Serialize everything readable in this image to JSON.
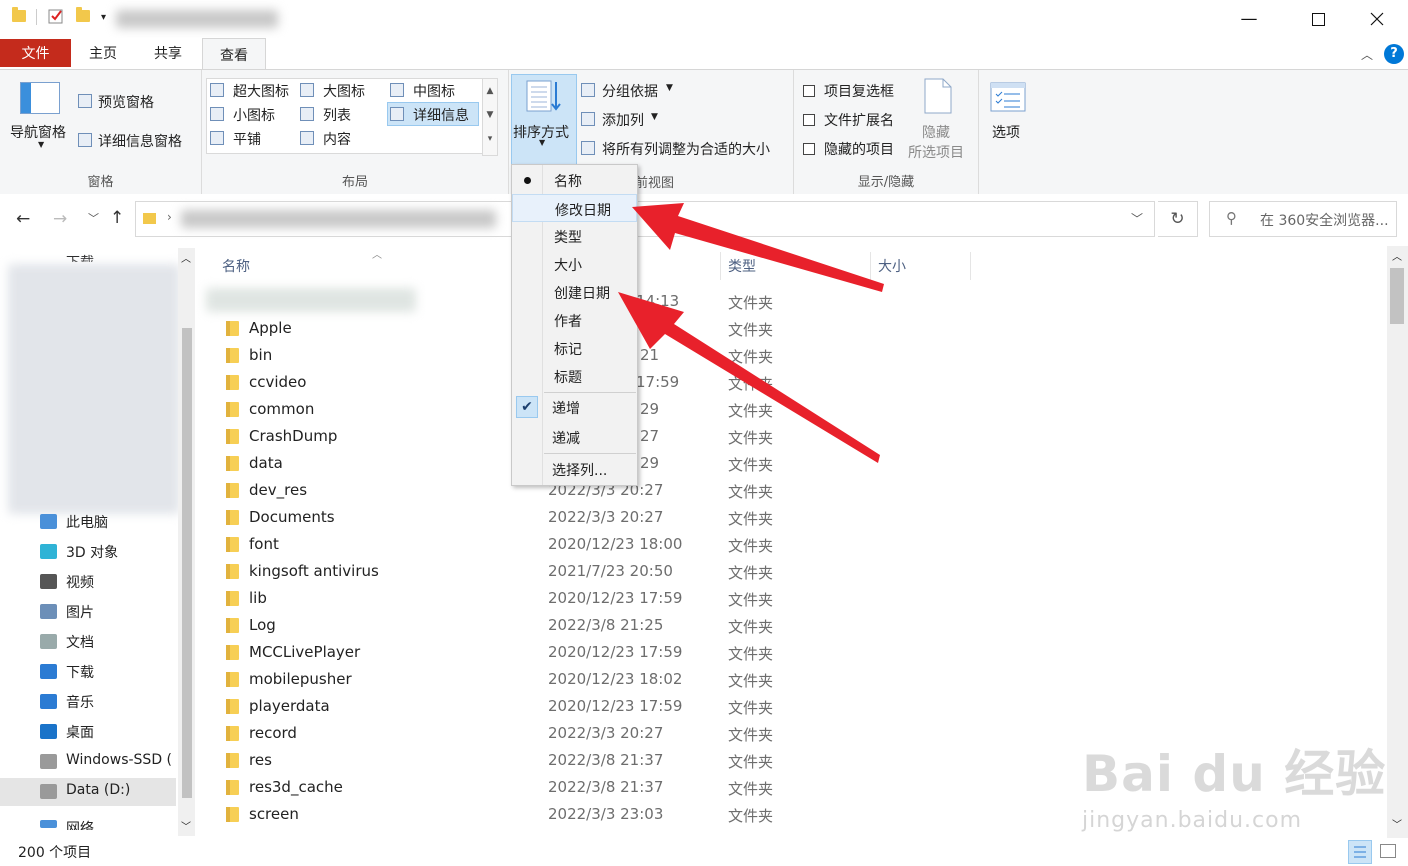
{
  "ribbon_tabs": {
    "file": "文件",
    "home": "主页",
    "share": "共享",
    "view": "查看"
  },
  "ribbon": {
    "panes": {
      "nav_pane": "导航窗格",
      "preview_pane": "预览窗格",
      "details_pane": "详细信息窗格",
      "label": "窗格"
    },
    "layout": {
      "extra_large": "超大图标",
      "large": "大图标",
      "medium": "中图标",
      "small": "小图标",
      "list": "列表",
      "details": "详细信息",
      "tiles": "平铺",
      "content": "内容",
      "label": "布局"
    },
    "current_view": {
      "sort_by": "排序方式",
      "group_by": "分组依据",
      "add_column": "添加列",
      "fit_columns": "将所有列调整为合适的大小",
      "label_tail": "前视图"
    },
    "show_hide": {
      "item_checkboxes": "项目复选框",
      "file_extensions": "文件扩展名",
      "hidden_items": "隐藏的项目",
      "hide_selected_1": "隐藏",
      "hide_selected_2": "所选项目",
      "label": "显示/隐藏"
    },
    "options": "选项"
  },
  "search": {
    "placeholder": "在 360安全浏览器..."
  },
  "left_pane": {
    "items": [
      {
        "label": "此电脑",
        "icon": "computer-icon"
      },
      {
        "label": "3D 对象",
        "icon": "cube-icon"
      },
      {
        "label": "视频",
        "icon": "video-icon"
      },
      {
        "label": "图片",
        "icon": "pictures-icon"
      },
      {
        "label": "文档",
        "icon": "documents-icon"
      },
      {
        "label": "下载",
        "icon": "download-icon"
      },
      {
        "label": "音乐",
        "icon": "music-icon"
      },
      {
        "label": "桌面",
        "icon": "desktop-icon"
      },
      {
        "label": "Windows-SSD (",
        "icon": "drive-icon"
      },
      {
        "label": "Data (D:)",
        "icon": "drive-icon"
      },
      {
        "label": "网络",
        "icon": "network-icon"
      }
    ],
    "top_partial": "下载"
  },
  "columns": {
    "name": "名称",
    "type": "类型",
    "size": "大小"
  },
  "files": [
    {
      "name": "",
      "date": "14:13",
      "type": "文件夹"
    },
    {
      "name": "Apple",
      "date": "",
      "type": "文件夹"
    },
    {
      "name": "bin",
      "date": "21",
      "type": "文件夹"
    },
    {
      "name": "ccvideo",
      "date": "17:59",
      "type": "文件夹"
    },
    {
      "name": "common",
      "date": "29",
      "type": "文件夹"
    },
    {
      "name": "CrashDump",
      "date": "27",
      "type": "文件夹"
    },
    {
      "name": "data",
      "date": "29",
      "type": "文件夹"
    },
    {
      "name": "dev_res",
      "date": "2022/3/3 20:27",
      "type": "文件夹"
    },
    {
      "name": "Documents",
      "date": "2022/3/3 20:27",
      "type": "文件夹"
    },
    {
      "name": "font",
      "date": "2020/12/23 18:00",
      "type": "文件夹"
    },
    {
      "name": "kingsoft antivirus",
      "date": "2021/7/23 20:50",
      "type": "文件夹"
    },
    {
      "name": "lib",
      "date": "2020/12/23 17:59",
      "type": "文件夹"
    },
    {
      "name": "Log",
      "date": "2022/3/8 21:25",
      "type": "文件夹"
    },
    {
      "name": "MCCLivePlayer",
      "date": "2020/12/23 17:59",
      "type": "文件夹"
    },
    {
      "name": "mobilepusher",
      "date": "2020/12/23 18:02",
      "type": "文件夹"
    },
    {
      "name": "playerdata",
      "date": "2020/12/23 17:59",
      "type": "文件夹"
    },
    {
      "name": "record",
      "date": "2022/3/3 20:27",
      "type": "文件夹"
    },
    {
      "name": "res",
      "date": "2022/3/8 21:37",
      "type": "文件夹"
    },
    {
      "name": "res3d_cache",
      "date": "2022/3/8 21:37",
      "type": "文件夹"
    },
    {
      "name": "screen",
      "date": "2022/3/3 23:03",
      "type": "文件夹"
    }
  ],
  "sort_menu": {
    "fields": [
      "名称",
      "修改日期",
      "类型",
      "大小",
      "创建日期",
      "作者",
      "标记",
      "标题"
    ],
    "selected_field": "名称",
    "highlighted": "修改日期",
    "order": [
      "递增",
      "递减"
    ],
    "selected_order": "递增",
    "choose_columns": "选择列..."
  },
  "status": {
    "item_count": "200 个项目"
  },
  "watermark": {
    "brand": "Bai du 经验",
    "url": "jingyan.baidu.com"
  },
  "colors": {
    "file_tab": "#c42b1c",
    "accent": "#0078d7",
    "arrow": "#e8212b",
    "folder": "#f7cf55"
  }
}
